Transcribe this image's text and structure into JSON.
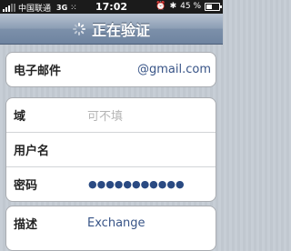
{
  "status_bar": {
    "carrier": "中国联通",
    "network": "3G",
    "time": "17:02",
    "battery": "45 %",
    "battery_level": 0.45
  },
  "nav": {
    "title": "正在验证"
  },
  "form": {
    "email_label": "电子邮件",
    "email_value": "@gmail.com",
    "domain_label": "域",
    "domain_placeholder": "可不填",
    "username_label": "用户名",
    "password_label": "密码",
    "password_value": "●●●●●●●●●●●",
    "description_label": "描述",
    "description_value": "Exchange"
  },
  "icons": [
    "signal-icon",
    "activity-icon",
    "spinner-icon",
    "alarm-icon",
    "bluetooth-icon",
    "battery-icon"
  ]
}
